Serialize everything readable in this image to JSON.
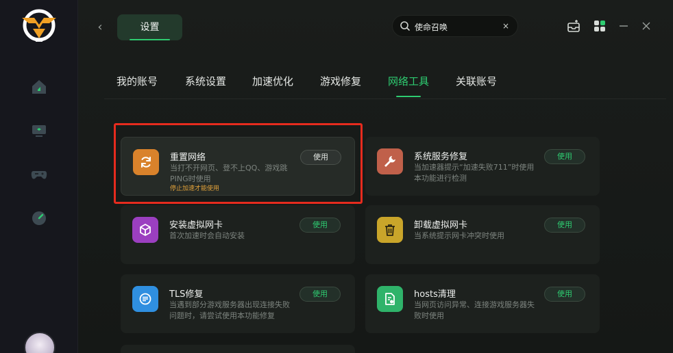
{
  "app": {
    "back_label": "‹",
    "settings_title": "设置"
  },
  "search": {
    "value": "使命召唤",
    "clear_label": "×"
  },
  "tabs": [
    {
      "label": "我的账号"
    },
    {
      "label": "系统设置"
    },
    {
      "label": "加速优化"
    },
    {
      "label": "游戏修复"
    },
    {
      "label": "网络工具"
    },
    {
      "label": "关联账号"
    }
  ],
  "active_tab": "网络工具",
  "tools": [
    {
      "title": "重置网络",
      "desc": "当打不开网页、登不上QQ、游戏跳PING时使用",
      "warning": "停止加速才能使用",
      "button": "使用",
      "icon": "refresh-icon",
      "color": "#d9822b"
    },
    {
      "title": "系统服务修复",
      "desc": "当加速器提示“加速失败711”时使用本功能进行检测",
      "button": "使用",
      "icon": "wrench-icon",
      "color": "#c0604a"
    },
    {
      "title": "安装虚拟网卡",
      "desc": "首次加速时会自动安装",
      "button": "使用",
      "icon": "cube-icon",
      "color": "#9b3fc0"
    },
    {
      "title": "卸载虚拟网卡",
      "desc": "当系统提示网卡冲突时使用",
      "button": "使用",
      "icon": "trash-icon",
      "color": "#c9a52a"
    },
    {
      "title": "TLS修复",
      "desc": "当遇到部分游戏服务器出现连接失败问题时，请尝试使用本功能修复",
      "button": "使用",
      "icon": "tls-icon",
      "color": "#2f8fe0"
    },
    {
      "title": "hosts清理",
      "desc": "当网页访问异常、连接游戏服务器失败时使用",
      "button": "使用",
      "icon": "file-clean-icon",
      "color": "#2fb36a"
    }
  ],
  "colors": {
    "accent": "#2ecc71",
    "highlight_frame": "#e62b1e",
    "warning": "#e0a03a"
  }
}
